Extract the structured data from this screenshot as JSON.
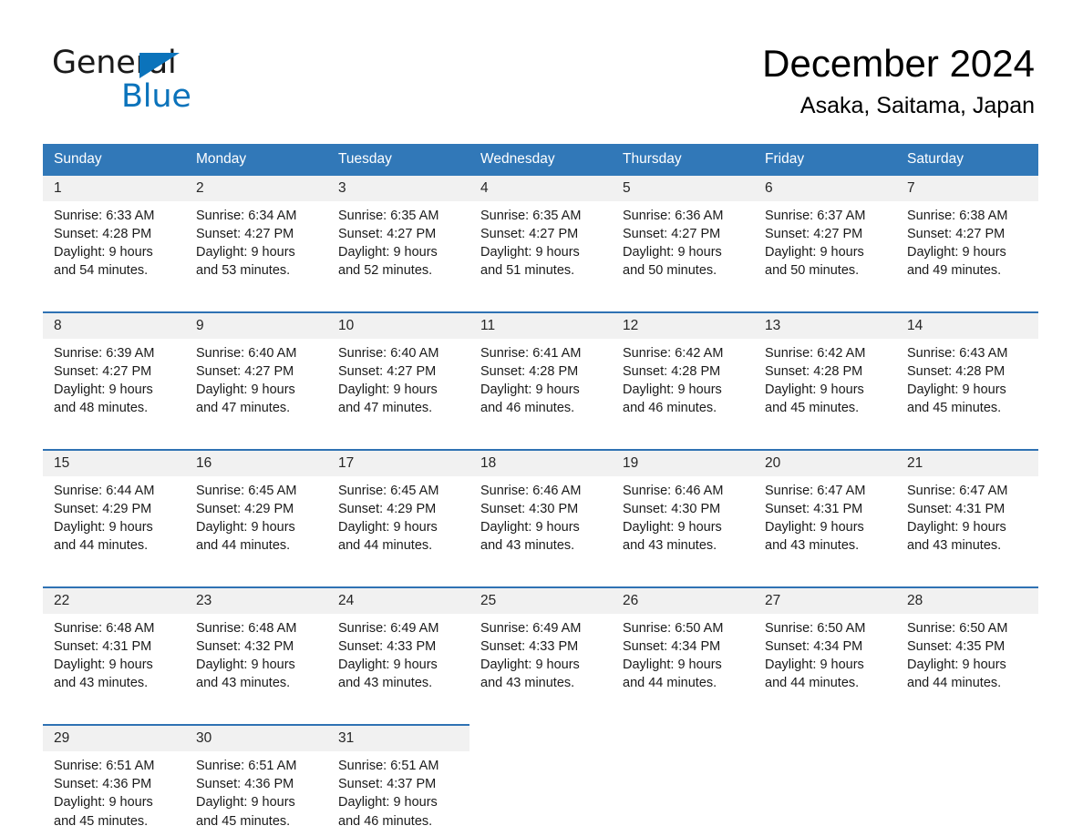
{
  "brand": {
    "word1": "General",
    "word2": "Blue",
    "accent_color": "#0b73bb",
    "triangle_icon": "right-triangle-icon"
  },
  "header": {
    "title": "December 2024",
    "location": "Asaka, Saitama, Japan"
  },
  "theme": {
    "header_blue": "#3178b8",
    "row_rule_blue": "#2f72b3",
    "daynum_band": "#f1f1f1"
  },
  "weekdays": [
    "Sunday",
    "Monday",
    "Tuesday",
    "Wednesday",
    "Thursday",
    "Friday",
    "Saturday"
  ],
  "weeks": [
    {
      "days": [
        {
          "date": "1",
          "sunrise": "Sunrise: 6:33 AM",
          "sunset": "Sunset: 4:28 PM",
          "daylight1": "Daylight: 9 hours",
          "daylight2": "and 54 minutes."
        },
        {
          "date": "2",
          "sunrise": "Sunrise: 6:34 AM",
          "sunset": "Sunset: 4:27 PM",
          "daylight1": "Daylight: 9 hours",
          "daylight2": "and 53 minutes."
        },
        {
          "date": "3",
          "sunrise": "Sunrise: 6:35 AM",
          "sunset": "Sunset: 4:27 PM",
          "daylight1": "Daylight: 9 hours",
          "daylight2": "and 52 minutes."
        },
        {
          "date": "4",
          "sunrise": "Sunrise: 6:35 AM",
          "sunset": "Sunset: 4:27 PM",
          "daylight1": "Daylight: 9 hours",
          "daylight2": "and 51 minutes."
        },
        {
          "date": "5",
          "sunrise": "Sunrise: 6:36 AM",
          "sunset": "Sunset: 4:27 PM",
          "daylight1": "Daylight: 9 hours",
          "daylight2": "and 50 minutes."
        },
        {
          "date": "6",
          "sunrise": "Sunrise: 6:37 AM",
          "sunset": "Sunset: 4:27 PM",
          "daylight1": "Daylight: 9 hours",
          "daylight2": "and 50 minutes."
        },
        {
          "date": "7",
          "sunrise": "Sunrise: 6:38 AM",
          "sunset": "Sunset: 4:27 PM",
          "daylight1": "Daylight: 9 hours",
          "daylight2": "and 49 minutes."
        }
      ]
    },
    {
      "days": [
        {
          "date": "8",
          "sunrise": "Sunrise: 6:39 AM",
          "sunset": "Sunset: 4:27 PM",
          "daylight1": "Daylight: 9 hours",
          "daylight2": "and 48 minutes."
        },
        {
          "date": "9",
          "sunrise": "Sunrise: 6:40 AM",
          "sunset": "Sunset: 4:27 PM",
          "daylight1": "Daylight: 9 hours",
          "daylight2": "and 47 minutes."
        },
        {
          "date": "10",
          "sunrise": "Sunrise: 6:40 AM",
          "sunset": "Sunset: 4:27 PM",
          "daylight1": "Daylight: 9 hours",
          "daylight2": "and 47 minutes."
        },
        {
          "date": "11",
          "sunrise": "Sunrise: 6:41 AM",
          "sunset": "Sunset: 4:28 PM",
          "daylight1": "Daylight: 9 hours",
          "daylight2": "and 46 minutes."
        },
        {
          "date": "12",
          "sunrise": "Sunrise: 6:42 AM",
          "sunset": "Sunset: 4:28 PM",
          "daylight1": "Daylight: 9 hours",
          "daylight2": "and 46 minutes."
        },
        {
          "date": "13",
          "sunrise": "Sunrise: 6:42 AM",
          "sunset": "Sunset: 4:28 PM",
          "daylight1": "Daylight: 9 hours",
          "daylight2": "and 45 minutes."
        },
        {
          "date": "14",
          "sunrise": "Sunrise: 6:43 AM",
          "sunset": "Sunset: 4:28 PM",
          "daylight1": "Daylight: 9 hours",
          "daylight2": "and 45 minutes."
        }
      ]
    },
    {
      "days": [
        {
          "date": "15",
          "sunrise": "Sunrise: 6:44 AM",
          "sunset": "Sunset: 4:29 PM",
          "daylight1": "Daylight: 9 hours",
          "daylight2": "and 44 minutes."
        },
        {
          "date": "16",
          "sunrise": "Sunrise: 6:45 AM",
          "sunset": "Sunset: 4:29 PM",
          "daylight1": "Daylight: 9 hours",
          "daylight2": "and 44 minutes."
        },
        {
          "date": "17",
          "sunrise": "Sunrise: 6:45 AM",
          "sunset": "Sunset: 4:29 PM",
          "daylight1": "Daylight: 9 hours",
          "daylight2": "and 44 minutes."
        },
        {
          "date": "18",
          "sunrise": "Sunrise: 6:46 AM",
          "sunset": "Sunset: 4:30 PM",
          "daylight1": "Daylight: 9 hours",
          "daylight2": "and 43 minutes."
        },
        {
          "date": "19",
          "sunrise": "Sunrise: 6:46 AM",
          "sunset": "Sunset: 4:30 PM",
          "daylight1": "Daylight: 9 hours",
          "daylight2": "and 43 minutes."
        },
        {
          "date": "20",
          "sunrise": "Sunrise: 6:47 AM",
          "sunset": "Sunset: 4:31 PM",
          "daylight1": "Daylight: 9 hours",
          "daylight2": "and 43 minutes."
        },
        {
          "date": "21",
          "sunrise": "Sunrise: 6:47 AM",
          "sunset": "Sunset: 4:31 PM",
          "daylight1": "Daylight: 9 hours",
          "daylight2": "and 43 minutes."
        }
      ]
    },
    {
      "days": [
        {
          "date": "22",
          "sunrise": "Sunrise: 6:48 AM",
          "sunset": "Sunset: 4:31 PM",
          "daylight1": "Daylight: 9 hours",
          "daylight2": "and 43 minutes."
        },
        {
          "date": "23",
          "sunrise": "Sunrise: 6:48 AM",
          "sunset": "Sunset: 4:32 PM",
          "daylight1": "Daylight: 9 hours",
          "daylight2": "and 43 minutes."
        },
        {
          "date": "24",
          "sunrise": "Sunrise: 6:49 AM",
          "sunset": "Sunset: 4:33 PM",
          "daylight1": "Daylight: 9 hours",
          "daylight2": "and 43 minutes."
        },
        {
          "date": "25",
          "sunrise": "Sunrise: 6:49 AM",
          "sunset": "Sunset: 4:33 PM",
          "daylight1": "Daylight: 9 hours",
          "daylight2": "and 43 minutes."
        },
        {
          "date": "26",
          "sunrise": "Sunrise: 6:50 AM",
          "sunset": "Sunset: 4:34 PM",
          "daylight1": "Daylight: 9 hours",
          "daylight2": "and 44 minutes."
        },
        {
          "date": "27",
          "sunrise": "Sunrise: 6:50 AM",
          "sunset": "Sunset: 4:34 PM",
          "daylight1": "Daylight: 9 hours",
          "daylight2": "and 44 minutes."
        },
        {
          "date": "28",
          "sunrise": "Sunrise: 6:50 AM",
          "sunset": "Sunset: 4:35 PM",
          "daylight1": "Daylight: 9 hours",
          "daylight2": "and 44 minutes."
        }
      ]
    },
    {
      "days": [
        {
          "date": "29",
          "sunrise": "Sunrise: 6:51 AM",
          "sunset": "Sunset: 4:36 PM",
          "daylight1": "Daylight: 9 hours",
          "daylight2": "and 45 minutes."
        },
        {
          "date": "30",
          "sunrise": "Sunrise: 6:51 AM",
          "sunset": "Sunset: 4:36 PM",
          "daylight1": "Daylight: 9 hours",
          "daylight2": "and 45 minutes."
        },
        {
          "date": "31",
          "sunrise": "Sunrise: 6:51 AM",
          "sunset": "Sunset: 4:37 PM",
          "daylight1": "Daylight: 9 hours",
          "daylight2": "and 46 minutes."
        },
        {
          "date": "",
          "sunrise": "",
          "sunset": "",
          "daylight1": "",
          "daylight2": ""
        },
        {
          "date": "",
          "sunrise": "",
          "sunset": "",
          "daylight1": "",
          "daylight2": ""
        },
        {
          "date": "",
          "sunrise": "",
          "sunset": "",
          "daylight1": "",
          "daylight2": ""
        },
        {
          "date": "",
          "sunrise": "",
          "sunset": "",
          "daylight1": "",
          "daylight2": ""
        }
      ]
    }
  ]
}
